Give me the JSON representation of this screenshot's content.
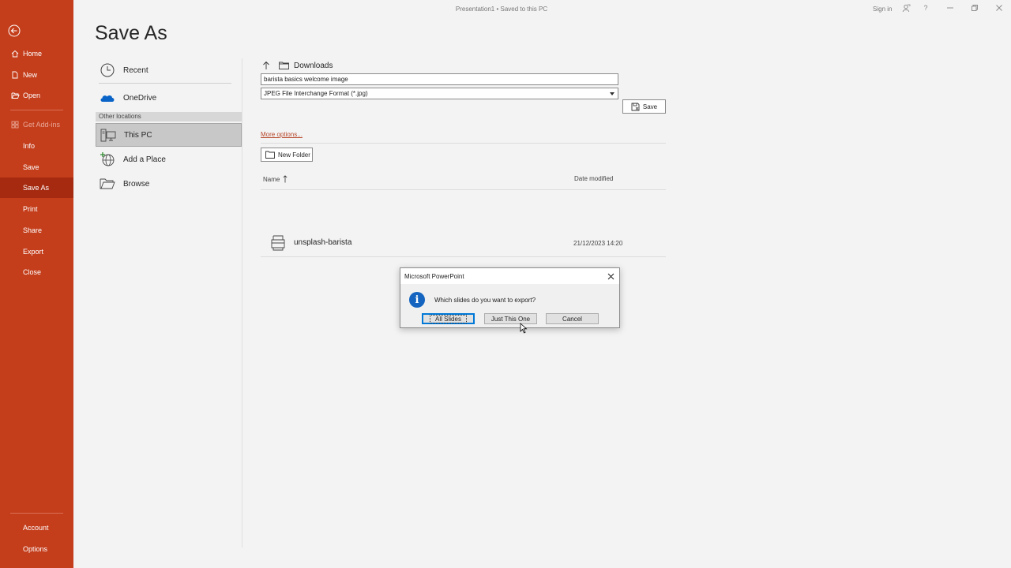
{
  "window": {
    "title": "Presentation1 • Saved to this PC",
    "sign_in": "Sign in"
  },
  "sidebar": {
    "items": [
      {
        "label": "Home"
      },
      {
        "label": "New"
      },
      {
        "label": "Open"
      },
      {
        "label": "Get Add-ins"
      },
      {
        "label": "Info"
      },
      {
        "label": "Save"
      },
      {
        "label": "Save As"
      },
      {
        "label": "Print"
      },
      {
        "label": "Share"
      },
      {
        "label": "Export"
      },
      {
        "label": "Close"
      }
    ],
    "bottom_items": [
      {
        "label": "Account"
      },
      {
        "label": "Options"
      }
    ],
    "active": "Save As",
    "accent_color": "#c43e1c"
  },
  "page": {
    "title": "Save As"
  },
  "locations": {
    "recent": "Recent",
    "onedrive": "OneDrive",
    "other_header": "Other locations",
    "this_pc": "This PC",
    "add_place": "Add a Place",
    "browse": "Browse"
  },
  "save_pane": {
    "current_folder": "Downloads",
    "filename": "barista basics welcome image",
    "filetype": "JPEG File Interchange Format (*.jpg)",
    "save_label": "Save",
    "more_options": "More options...",
    "new_folder": "New Folder",
    "columns": {
      "name": "Name",
      "date": "Date modified"
    },
    "files": [
      {
        "name": "unsplash-barista",
        "date": "21/12/2023 14:20"
      }
    ]
  },
  "dialog": {
    "title": "Microsoft PowerPoint",
    "message": "Which slides do you want to export?",
    "buttons": {
      "all": "All Slides",
      "one": "Just This One",
      "cancel": "Cancel"
    }
  }
}
